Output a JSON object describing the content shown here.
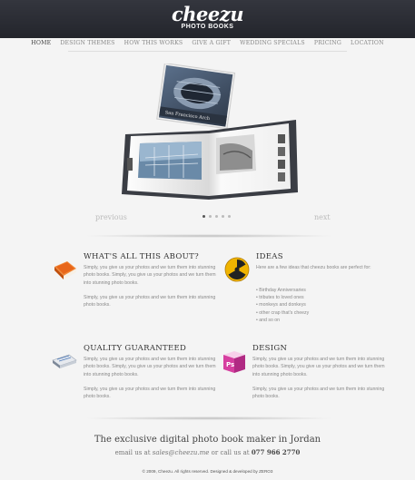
{
  "header": {
    "brand": "cheezu",
    "subtitle": "PHOTO BOOKS"
  },
  "nav": [
    {
      "label": "HOME",
      "active": true
    },
    {
      "label": "DESIGN THEMES"
    },
    {
      "label": "HOW THIS WORKS"
    },
    {
      "label": "GIVE A GIFT"
    },
    {
      "label": "WEDDING SPECIALS"
    },
    {
      "label": "PRICING"
    },
    {
      "label": "LOCATION"
    }
  ],
  "slider": {
    "prev": "previous",
    "next": "next",
    "book_cover_title": "San Francisco Arch"
  },
  "features": {
    "about": {
      "title": "WHAT'S ALL THIS ABOUT?",
      "p1": "Simply, you give us your photos and we turn them into stunning photo books. Simply, you give us your photos and we turn them into stunning photo books.",
      "p2": "Simply, you give us your photos and we turn them into stunning photo books."
    },
    "ideas": {
      "title": "IDEAS",
      "intro": "Here are a few ideas that cheezu books are perfect for:",
      "items": [
        "Birthday Anniversaries",
        "tributes to loved ones",
        "monkeys and donkeys",
        "other crap that's cheezy",
        "and so on"
      ]
    },
    "quality": {
      "title": "QUALITY GUARANTEED",
      "p1": "Simply, you give us your photos and we turn them into stunning photo books. Simply, you give us your photos and we turn them into stunning photo books.",
      "p2": "Simply, you give us your photos and we turn them into stunning photo books."
    },
    "design": {
      "title": "DESIGN",
      "p1": "Simply, you give us your photos and we turn them into stunning photo books. Simply, you give us your photos and we turn them into stunning photo books.",
      "p2": "Simply, you give us your photos and we turn them into stunning photo books."
    }
  },
  "cta": {
    "tagline": "The exclusive digital photo book maker in Jordan",
    "email_prefix": "email us at",
    "email": "sales@cheezu.me",
    "or_call": "or call us at",
    "phone": "077 966 2770"
  },
  "footer": {
    "text": "© 2009, Cheezu. All rights reserved.   Designed & developed by ZERO3"
  },
  "colors": {
    "topbar": "#2c2e35",
    "icon_book": "#e8661a",
    "icon_radiation": "#f0b400",
    "icon_design": "#d63fa0"
  }
}
